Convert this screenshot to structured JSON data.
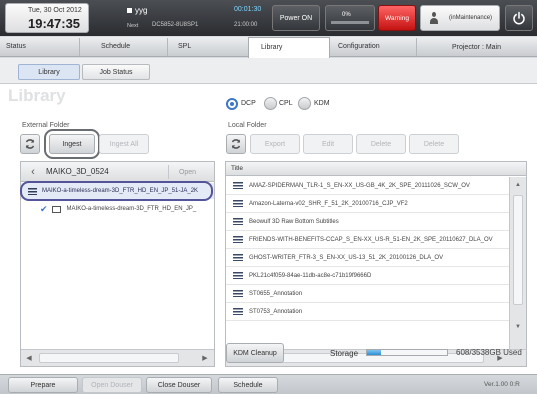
{
  "header": {
    "date": "Tue, 30 Oct 2012",
    "time": "19:47:35",
    "now_title": "yyg",
    "now_time": "00:01:30",
    "next_label": "Next",
    "next_title": "DC5852-8U8SP1",
    "next_time": "21:00:00",
    "power_label": "Power ON",
    "progress_percent": "0%",
    "warning_label": "Warning",
    "user_label": "(inMaintenance)"
  },
  "main_tabs": [
    {
      "label": "Status"
    },
    {
      "label": "Schedule"
    },
    {
      "label": "SPL"
    },
    {
      "label": "Library"
    },
    {
      "label": "Configuration"
    },
    {
      "label": "Projector : Main"
    }
  ],
  "sub_tabs": [
    {
      "label": "Library"
    },
    {
      "label": "Job Status"
    }
  ],
  "page_title": "Library",
  "filter": {
    "options": [
      "DCP",
      "CPL",
      "KDM"
    ],
    "selected": "DCP"
  },
  "external": {
    "title": "External Folder",
    "ingest_label": "Ingest",
    "ingest_all_label": "Ingest All",
    "path": "MAIKO_3D_0524",
    "open_label": "Open",
    "items": [
      "MAIKO-a-timeless-dream-3D_FTR_HD_EN_JP_51-JA_2K",
      "MAIKO-a-timeless-dream-3D_FTR_HD_EN_JP_"
    ]
  },
  "local": {
    "title": "Local Folder",
    "buttons": [
      "Export",
      "Edit",
      "Delete",
      "Delete"
    ],
    "column_header": "Title",
    "rows": [
      "AMAZ-SPIDERMAN_TLR-1_S_EN-XX_US-GB_4K_2K_SPE_20111026_SCW_OV",
      "Amazon-Laterna-v02_SHR_F_51_2K_20100716_CJP_VF2",
      "Beowulf 3D Raw Bottom Subtitles",
      "FRIENDS-WITH-BENEFITS-CCAP_S_EN-XX_US-R_51-EN_2K_SPE_20110627_DLA_OV",
      "GHOST-WRITER_FTR-3_S_EN-XX_US-13_51_2K_20100126_DLA_OV",
      "PKL21c4f059-84ae-11db-ac8e-c71b19f9666D",
      "ST0655_Annotation",
      "ST0753_Annotation"
    ],
    "kdm_cleanup_label": "KDM Cleanup",
    "storage_label": "Storage",
    "storage_fraction": 0.17,
    "storage_text": "608/3538GB Used"
  },
  "footer": {
    "buttons": [
      "Prepare",
      "Open Douser",
      "Close Douser",
      "Schedule"
    ],
    "version": "Ver.1.00 0:R"
  }
}
